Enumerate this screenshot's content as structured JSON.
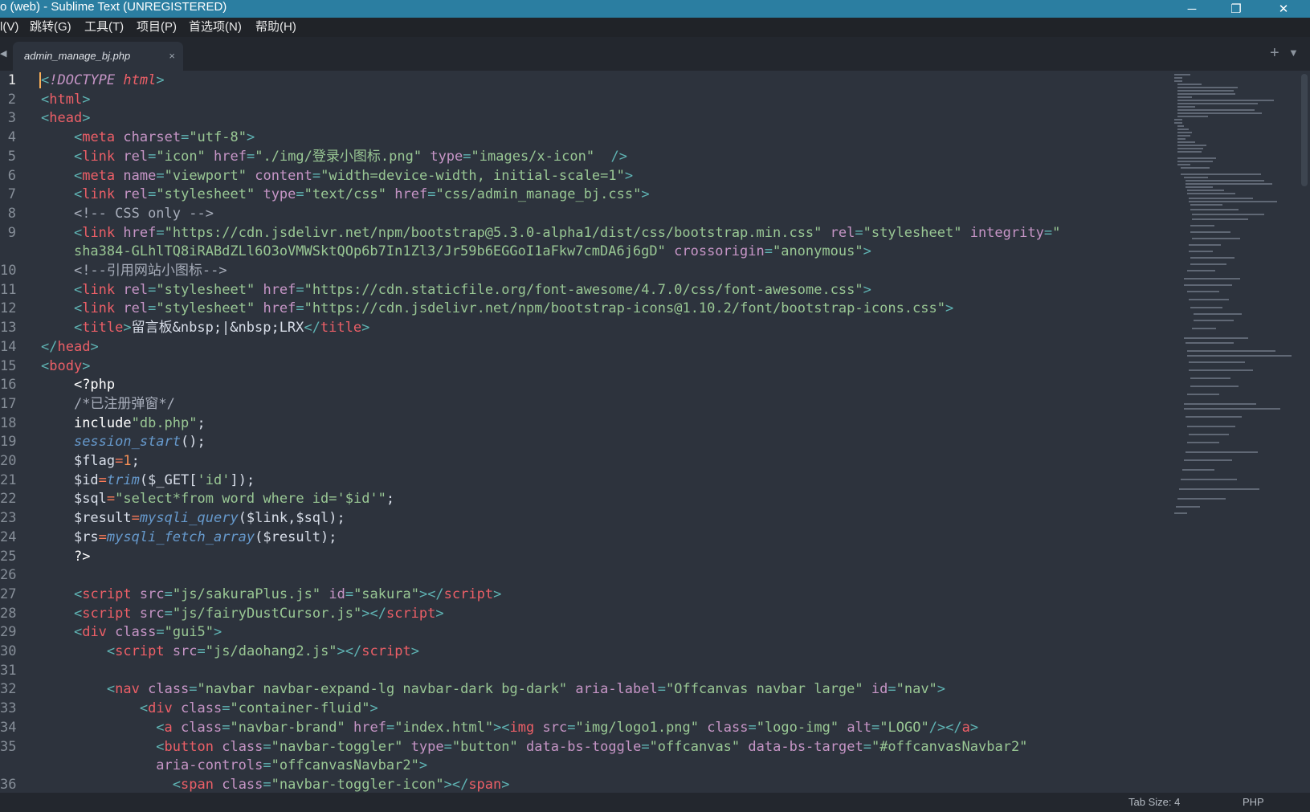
{
  "window": {
    "title": "o (web) - Sublime Text (UNREGISTERED)",
    "controls": {
      "minimize": "─",
      "maximize": "❐",
      "close": "✕"
    }
  },
  "menu": {
    "items": [
      "l(V)",
      "跳转(G)",
      "工具(T)",
      "项目(P)",
      "首选项(N)",
      "帮助(H)"
    ]
  },
  "tabs": {
    "active": {
      "label": "admin_manage_bj.php",
      "close": "×"
    },
    "left_arrow": "◀",
    "add": "+",
    "dropdown": "▼"
  },
  "editor": {
    "active_line": 1,
    "line_numbers": [
      "1",
      "2",
      "3",
      "4",
      "5",
      "6",
      "7",
      "8",
      "9",
      "",
      "10",
      "11",
      "12",
      "13",
      "14",
      "15",
      "16",
      "17",
      "18",
      "19",
      "20",
      "21",
      "22",
      "23",
      "24",
      "25",
      "26",
      "27",
      "28",
      "29",
      "30",
      "31",
      "32",
      "33",
      "34",
      "35",
      "",
      "36"
    ],
    "lines": [
      [
        [
          "punct",
          "<"
        ],
        [
          "doctype",
          "!DOCTYPE"
        ],
        [
          "text",
          " "
        ],
        [
          "doctype-kw",
          "html"
        ],
        [
          "punct",
          ">"
        ]
      ],
      [
        [
          "punct",
          "<"
        ],
        [
          "tag",
          "html"
        ],
        [
          "punct",
          ">"
        ]
      ],
      [
        [
          "punct",
          "<"
        ],
        [
          "tag",
          "head"
        ],
        [
          "punct",
          ">"
        ]
      ],
      [
        [
          "text",
          "    "
        ],
        [
          "punct",
          "<"
        ],
        [
          "tag",
          "meta"
        ],
        [
          "text",
          " "
        ],
        [
          "attr",
          "charset"
        ],
        [
          "punct",
          "="
        ],
        [
          "str",
          "\"utf-8\""
        ],
        [
          "punct",
          ">"
        ]
      ],
      [
        [
          "text",
          "    "
        ],
        [
          "punct",
          "<"
        ],
        [
          "tag",
          "link"
        ],
        [
          "text",
          " "
        ],
        [
          "attr",
          "rel"
        ],
        [
          "punct",
          "="
        ],
        [
          "str",
          "\"icon\""
        ],
        [
          "text",
          " "
        ],
        [
          "attr",
          "href"
        ],
        [
          "punct",
          "="
        ],
        [
          "str",
          "\"./img/登录小图标.png\""
        ],
        [
          "text",
          " "
        ],
        [
          "attr",
          "type"
        ],
        [
          "punct",
          "="
        ],
        [
          "str",
          "\"images/x-icon\""
        ],
        [
          "text",
          "  "
        ],
        [
          "punct",
          "/>"
        ]
      ],
      [
        [
          "text",
          "    "
        ],
        [
          "punct",
          "<"
        ],
        [
          "tag",
          "meta"
        ],
        [
          "text",
          " "
        ],
        [
          "attr",
          "name"
        ],
        [
          "punct",
          "="
        ],
        [
          "str",
          "\"viewport\""
        ],
        [
          "text",
          " "
        ],
        [
          "attr",
          "content"
        ],
        [
          "punct",
          "="
        ],
        [
          "str",
          "\"width=device-width, initial-scale=1\""
        ],
        [
          "punct",
          ">"
        ]
      ],
      [
        [
          "text",
          "    "
        ],
        [
          "punct",
          "<"
        ],
        [
          "tag",
          "link"
        ],
        [
          "text",
          " "
        ],
        [
          "attr",
          "rel"
        ],
        [
          "punct",
          "="
        ],
        [
          "str",
          "\"stylesheet\""
        ],
        [
          "text",
          " "
        ],
        [
          "attr",
          "type"
        ],
        [
          "punct",
          "="
        ],
        [
          "str",
          "\"text/css\""
        ],
        [
          "text",
          " "
        ],
        [
          "attr",
          "href"
        ],
        [
          "punct",
          "="
        ],
        [
          "str",
          "\"css/admin_manage_bj.css\""
        ],
        [
          "punct",
          ">"
        ]
      ],
      [
        [
          "text",
          "    "
        ],
        [
          "cmt",
          "<!-- CSS only -->"
        ]
      ],
      [
        [
          "text",
          "    "
        ],
        [
          "punct",
          "<"
        ],
        [
          "tag",
          "link"
        ],
        [
          "text",
          " "
        ],
        [
          "attr",
          "href"
        ],
        [
          "punct",
          "="
        ],
        [
          "str",
          "\"https://cdn.jsdelivr.net/npm/bootstrap@5.3.0-alpha1/dist/css/bootstrap.min.css\""
        ],
        [
          "text",
          " "
        ],
        [
          "attr",
          "rel"
        ],
        [
          "punct",
          "="
        ],
        [
          "str",
          "\"stylesheet\""
        ],
        [
          "text",
          " "
        ],
        [
          "attr",
          "integrity"
        ],
        [
          "punct",
          "="
        ],
        [
          "str",
          "\""
        ]
      ],
      [
        [
          "text",
          "    "
        ],
        [
          "str",
          "sha384-GLhlTQ8iRABdZLl6O3oVMWSktQOp6b7In1Zl3/Jr59b6EGGoI1aFkw7cmDA6j6gD\""
        ],
        [
          "text",
          " "
        ],
        [
          "attr",
          "crossorigin"
        ],
        [
          "punct",
          "="
        ],
        [
          "str",
          "\"anonymous\""
        ],
        [
          "punct",
          ">"
        ]
      ],
      [
        [
          "text",
          "    "
        ],
        [
          "cmt",
          "<!--引用网站小图标-->"
        ]
      ],
      [
        [
          "text",
          "    "
        ],
        [
          "punct",
          "<"
        ],
        [
          "tag",
          "link"
        ],
        [
          "text",
          " "
        ],
        [
          "attr",
          "rel"
        ],
        [
          "punct",
          "="
        ],
        [
          "str",
          "\"stylesheet\""
        ],
        [
          "text",
          " "
        ],
        [
          "attr",
          "href"
        ],
        [
          "punct",
          "="
        ],
        [
          "str",
          "\"https://cdn.staticfile.org/font-awesome/4.7.0/css/font-awesome.css\""
        ],
        [
          "punct",
          ">"
        ]
      ],
      [
        [
          "text",
          "    "
        ],
        [
          "punct",
          "<"
        ],
        [
          "tag",
          "link"
        ],
        [
          "text",
          " "
        ],
        [
          "attr",
          "rel"
        ],
        [
          "punct",
          "="
        ],
        [
          "str",
          "\"stylesheet\""
        ],
        [
          "text",
          " "
        ],
        [
          "attr",
          "href"
        ],
        [
          "punct",
          "="
        ],
        [
          "str",
          "\"https://cdn.jsdelivr.net/npm/bootstrap-icons@1.10.2/font/bootstrap-icons.css\""
        ],
        [
          "punct",
          ">"
        ]
      ],
      [
        [
          "text",
          "    "
        ],
        [
          "punct",
          "<"
        ],
        [
          "tag",
          "title"
        ],
        [
          "punct",
          ">"
        ],
        [
          "text",
          "留言板&nbsp;|&nbsp;LRX"
        ],
        [
          "punct",
          "</"
        ],
        [
          "tag",
          "title"
        ],
        [
          "punct",
          ">"
        ]
      ],
      [
        [
          "punct",
          "</"
        ],
        [
          "tag",
          "head"
        ],
        [
          "punct",
          ">"
        ]
      ],
      [
        [
          "punct",
          "<"
        ],
        [
          "tag",
          "body"
        ],
        [
          "punct",
          ">"
        ]
      ],
      [
        [
          "text",
          "    "
        ],
        [
          "php",
          "<?php"
        ]
      ],
      [
        [
          "text",
          "    "
        ],
        [
          "cmt",
          "/*已注册弹窗*/"
        ]
      ],
      [
        [
          "text",
          "    "
        ],
        [
          "php",
          "include"
        ],
        [
          "str",
          "\"db.php\""
        ],
        [
          "text",
          ";"
        ]
      ],
      [
        [
          "text",
          "    "
        ],
        [
          "func",
          "session_start"
        ],
        [
          "text",
          "();"
        ]
      ],
      [
        [
          "text",
          "    "
        ],
        [
          "var",
          "$flag"
        ],
        [
          "op",
          "="
        ],
        [
          "num",
          "1"
        ],
        [
          "text",
          ";"
        ]
      ],
      [
        [
          "text",
          "    "
        ],
        [
          "var",
          "$id"
        ],
        [
          "op",
          "="
        ],
        [
          "func",
          "trim"
        ],
        [
          "text",
          "($_GET["
        ],
        [
          "str",
          "'id'"
        ],
        [
          "text",
          "]);"
        ]
      ],
      [
        [
          "text",
          "    "
        ],
        [
          "var",
          "$sql"
        ],
        [
          "op",
          "="
        ],
        [
          "str",
          "\"select*from word where id='$id'\""
        ],
        [
          "text",
          ";"
        ]
      ],
      [
        [
          "text",
          "    "
        ],
        [
          "var",
          "$result"
        ],
        [
          "op",
          "="
        ],
        [
          "func",
          "mysqli_query"
        ],
        [
          "text",
          "($link,$sql);"
        ]
      ],
      [
        [
          "text",
          "    "
        ],
        [
          "var",
          "$rs"
        ],
        [
          "op",
          "="
        ],
        [
          "func",
          "mysqli_fetch_array"
        ],
        [
          "text",
          "($result);"
        ]
      ],
      [
        [
          "text",
          "    "
        ],
        [
          "php",
          "?>"
        ]
      ],
      [
        [
          "text",
          ""
        ]
      ],
      [
        [
          "text",
          "    "
        ],
        [
          "punct",
          "<"
        ],
        [
          "tag",
          "script"
        ],
        [
          "text",
          " "
        ],
        [
          "attr",
          "src"
        ],
        [
          "punct",
          "="
        ],
        [
          "str",
          "\"js/sakuraPlus.js\""
        ],
        [
          "text",
          " "
        ],
        [
          "attr",
          "id"
        ],
        [
          "punct",
          "="
        ],
        [
          "str",
          "\"sakura\""
        ],
        [
          "punct",
          "></"
        ],
        [
          "tag",
          "script"
        ],
        [
          "punct",
          ">"
        ]
      ],
      [
        [
          "text",
          "    "
        ],
        [
          "punct",
          "<"
        ],
        [
          "tag",
          "script"
        ],
        [
          "text",
          " "
        ],
        [
          "attr",
          "src"
        ],
        [
          "punct",
          "="
        ],
        [
          "str",
          "\"js/fairyDustCursor.js\""
        ],
        [
          "punct",
          "></"
        ],
        [
          "tag",
          "script"
        ],
        [
          "punct",
          ">"
        ]
      ],
      [
        [
          "text",
          "    "
        ],
        [
          "punct",
          "<"
        ],
        [
          "tag",
          "div"
        ],
        [
          "text",
          " "
        ],
        [
          "attr",
          "class"
        ],
        [
          "punct",
          "="
        ],
        [
          "str",
          "\"gui5\""
        ],
        [
          "punct",
          ">"
        ]
      ],
      [
        [
          "text",
          "        "
        ],
        [
          "punct",
          "<"
        ],
        [
          "tag",
          "script"
        ],
        [
          "text",
          " "
        ],
        [
          "attr",
          "src"
        ],
        [
          "punct",
          "="
        ],
        [
          "str",
          "\"js/daohang2.js\""
        ],
        [
          "punct",
          "></"
        ],
        [
          "tag",
          "script"
        ],
        [
          "punct",
          ">"
        ]
      ],
      [
        [
          "text",
          ""
        ]
      ],
      [
        [
          "text",
          "        "
        ],
        [
          "punct",
          "<"
        ],
        [
          "tag",
          "nav"
        ],
        [
          "text",
          " "
        ],
        [
          "attr",
          "class"
        ],
        [
          "punct",
          "="
        ],
        [
          "str",
          "\"navbar navbar-expand-lg navbar-dark bg-dark\""
        ],
        [
          "text",
          " "
        ],
        [
          "attr",
          "aria-label"
        ],
        [
          "punct",
          "="
        ],
        [
          "str",
          "\"Offcanvas navbar large\""
        ],
        [
          "text",
          " "
        ],
        [
          "attr",
          "id"
        ],
        [
          "punct",
          "="
        ],
        [
          "str",
          "\"nav\""
        ],
        [
          "punct",
          ">"
        ]
      ],
      [
        [
          "text",
          "            "
        ],
        [
          "punct",
          "<"
        ],
        [
          "tag",
          "div"
        ],
        [
          "text",
          " "
        ],
        [
          "attr",
          "class"
        ],
        [
          "punct",
          "="
        ],
        [
          "str",
          "\"container-fluid\""
        ],
        [
          "punct",
          ">"
        ]
      ],
      [
        [
          "text",
          "              "
        ],
        [
          "punct",
          "<"
        ],
        [
          "tag",
          "a"
        ],
        [
          "text",
          " "
        ],
        [
          "attr",
          "class"
        ],
        [
          "punct",
          "="
        ],
        [
          "str",
          "\"navbar-brand\""
        ],
        [
          "text",
          " "
        ],
        [
          "attr",
          "href"
        ],
        [
          "punct",
          "="
        ],
        [
          "str",
          "\"index.html\""
        ],
        [
          "punct",
          "><"
        ],
        [
          "tag",
          "img"
        ],
        [
          "text",
          " "
        ],
        [
          "attr",
          "src"
        ],
        [
          "punct",
          "="
        ],
        [
          "str",
          "\"img/logo1.png\""
        ],
        [
          "text",
          " "
        ],
        [
          "attr",
          "class"
        ],
        [
          "punct",
          "="
        ],
        [
          "str",
          "\"logo-img\""
        ],
        [
          "text",
          " "
        ],
        [
          "attr",
          "alt"
        ],
        [
          "punct",
          "="
        ],
        [
          "str",
          "\"LOGO\""
        ],
        [
          "punct",
          "/></"
        ],
        [
          "tag",
          "a"
        ],
        [
          "punct",
          ">"
        ]
      ],
      [
        [
          "text",
          "              "
        ],
        [
          "punct",
          "<"
        ],
        [
          "tag",
          "button"
        ],
        [
          "text",
          " "
        ],
        [
          "attr",
          "class"
        ],
        [
          "punct",
          "="
        ],
        [
          "str",
          "\"navbar-toggler\""
        ],
        [
          "text",
          " "
        ],
        [
          "attr",
          "type"
        ],
        [
          "punct",
          "="
        ],
        [
          "str",
          "\"button\""
        ],
        [
          "text",
          " "
        ],
        [
          "attr",
          "data-bs-toggle"
        ],
        [
          "punct",
          "="
        ],
        [
          "str",
          "\"offcanvas\""
        ],
        [
          "text",
          " "
        ],
        [
          "attr",
          "data-bs-target"
        ],
        [
          "punct",
          "="
        ],
        [
          "str",
          "\"#offcanvasNavbar2\""
        ]
      ],
      [
        [
          "text",
          "              "
        ],
        [
          "attr",
          "aria-controls"
        ],
        [
          "punct",
          "="
        ],
        [
          "str",
          "\"offcanvasNavbar2\""
        ],
        [
          "punct",
          ">"
        ]
      ],
      [
        [
          "text",
          "                "
        ],
        [
          "punct",
          "<"
        ],
        [
          "tag",
          "span"
        ],
        [
          "text",
          " "
        ],
        [
          "attr",
          "class"
        ],
        [
          "punct",
          "="
        ],
        [
          "str",
          "\"navbar-toggler-icon\""
        ],
        [
          "punct",
          "></"
        ],
        [
          "tag",
          "span"
        ],
        [
          "punct",
          ">"
        ]
      ]
    ]
  },
  "status": {
    "tab_size": "Tab Size: 4",
    "syntax": "PHP"
  }
}
